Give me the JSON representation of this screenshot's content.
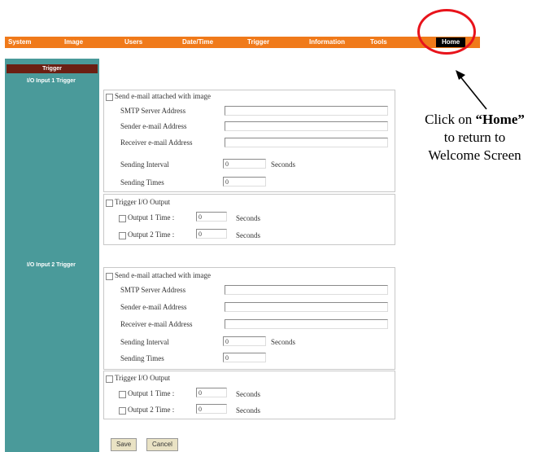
{
  "nav": {
    "items": [
      "System",
      "Image",
      "Users",
      "Date/Time",
      "Trigger",
      "Information",
      "Tools",
      "Home"
    ]
  },
  "sidebar": {
    "tab": "Trigger",
    "section1": "I/O Input 1 Trigger",
    "section2": "I/O Input 2 Trigger"
  },
  "annotation": {
    "line1_prefix": "Click on ",
    "line1_bold": "“Home”",
    "line2": "to return to",
    "line3": "Welcome Screen"
  },
  "sections": [
    {
      "email_check_label": "Send e-mail attached with image",
      "smtp_label": "SMTP Server Address",
      "smtp_value": "",
      "sender_label": "Sender e-mail Address",
      "sender_value": "",
      "receiver_label": "Receiver e-mail Address",
      "receiver_value": "",
      "interval_label": "Sending Interval",
      "interval_value": "0",
      "interval_unit": "Seconds",
      "times_label": "Sending Times",
      "times_value": "0",
      "io_check_label": "Trigger I/O Output",
      "out1_label": "Output 1 Time :",
      "out1_value": "0",
      "out1_unit": "Seconds",
      "out2_label": "Output 2 Time :",
      "out2_value": "0",
      "out2_unit": "Seconds"
    },
    {
      "email_check_label": "Send e-mail attached with image",
      "smtp_label": "SMTP Server Address",
      "smtp_value": "",
      "sender_label": "Sender e-mail Address",
      "sender_value": "",
      "receiver_label": "Receiver e-mail Address",
      "receiver_value": "",
      "interval_label": "Sending Interval",
      "interval_value": "0",
      "interval_unit": "Seconds",
      "times_label": "Sending Times",
      "times_value": "0",
      "io_check_label": "Trigger I/O Output",
      "out1_label": "Output 1 Time :",
      "out1_value": "0",
      "out1_unit": "Seconds",
      "out2_label": "Output 2 Time :",
      "out2_value": "0",
      "out2_unit": "Seconds"
    }
  ],
  "buttons": {
    "save": "Save",
    "cancel": "Cancel"
  },
  "colors": {
    "nav": "#f07a1a",
    "sidebar": "#4a9a9a",
    "tab": "#6b1f13",
    "annotation_circle": "#e8131b"
  }
}
